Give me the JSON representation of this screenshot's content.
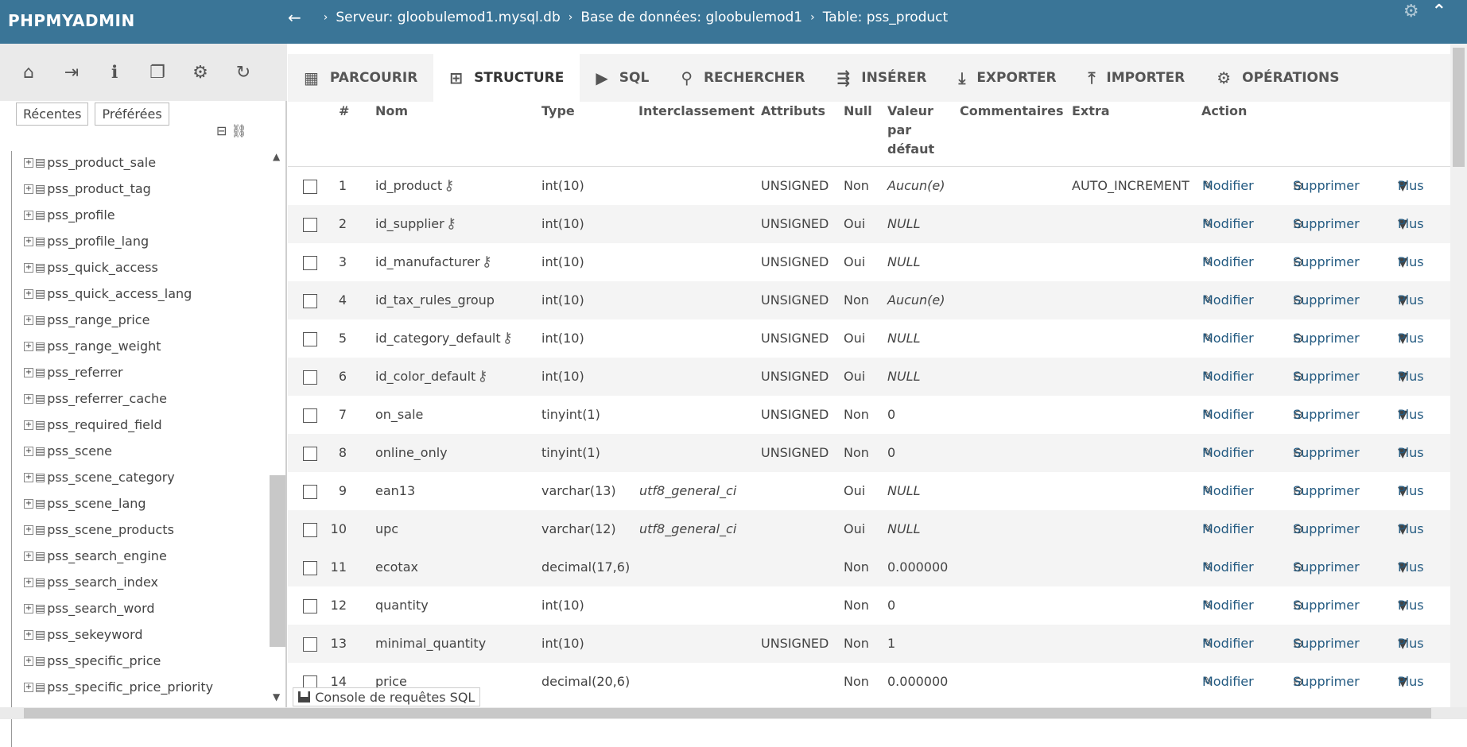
{
  "app": {
    "logo": "PHPMYADMIN"
  },
  "breadcrumb": {
    "back": "←",
    "server": "Serveur: gloobulemod1.mysql.db",
    "database": "Base de données: gloobulemod1",
    "table": "Table: pss_product"
  },
  "sidebar": {
    "tabs": {
      "recent": "Récentes",
      "favorites": "Préférées"
    },
    "tree": [
      "pss_product_sale",
      "pss_product_tag",
      "pss_profile",
      "pss_profile_lang",
      "pss_quick_access",
      "pss_quick_access_lang",
      "pss_range_price",
      "pss_range_weight",
      "pss_referrer",
      "pss_referrer_cache",
      "pss_required_field",
      "pss_scene",
      "pss_scene_category",
      "pss_scene_lang",
      "pss_scene_products",
      "pss_search_engine",
      "pss_search_index",
      "pss_search_word",
      "pss_sekeyword",
      "pss_specific_price",
      "pss_specific_price_priority"
    ]
  },
  "tabs": [
    "PARCOURIR",
    "STRUCTURE",
    "SQL",
    "RECHERCHER",
    "INSÉRER",
    "EXPORTER",
    "IMPORTER",
    "OPÉRATIONS"
  ],
  "table": {
    "headers": {
      "num": "#",
      "name": "Nom",
      "type": "Type",
      "collation": "Interclassement",
      "attributes": "Attributs",
      "null": "Null",
      "default": "Valeur par défaut",
      "comments": "Commentaires",
      "extra": "Extra",
      "action": "Action"
    },
    "action_labels": {
      "edit": "Modifier",
      "delete": "Supprimer",
      "more": "Plus"
    },
    "rows": [
      {
        "num": "1",
        "name": "id_product",
        "key": true,
        "type": "int(10)",
        "collation": "",
        "attributes": "UNSIGNED",
        "null": "Non",
        "default": "Aucun(e)",
        "default_italic": true,
        "extra": "AUTO_INCREMENT"
      },
      {
        "num": "2",
        "name": "id_supplier",
        "key": true,
        "type": "int(10)",
        "collation": "",
        "attributes": "UNSIGNED",
        "null": "Oui",
        "default": "NULL",
        "default_italic": true,
        "extra": ""
      },
      {
        "num": "3",
        "name": "id_manufacturer",
        "key": true,
        "type": "int(10)",
        "collation": "",
        "attributes": "UNSIGNED",
        "null": "Oui",
        "default": "NULL",
        "default_italic": true,
        "extra": ""
      },
      {
        "num": "4",
        "name": "id_tax_rules_group",
        "key": false,
        "type": "int(10)",
        "collation": "",
        "attributes": "UNSIGNED",
        "null": "Non",
        "default": "Aucun(e)",
        "default_italic": true,
        "extra": ""
      },
      {
        "num": "5",
        "name": "id_category_default",
        "key": true,
        "type": "int(10)",
        "collation": "",
        "attributes": "UNSIGNED",
        "null": "Oui",
        "default": "NULL",
        "default_italic": true,
        "extra": ""
      },
      {
        "num": "6",
        "name": "id_color_default",
        "key": true,
        "type": "int(10)",
        "collation": "",
        "attributes": "UNSIGNED",
        "null": "Oui",
        "default": "NULL",
        "default_italic": true,
        "extra": ""
      },
      {
        "num": "7",
        "name": "on_sale",
        "key": false,
        "type": "tinyint(1)",
        "collation": "",
        "attributes": "UNSIGNED",
        "null": "Non",
        "default": "0",
        "default_italic": false,
        "extra": ""
      },
      {
        "num": "8",
        "name": "online_only",
        "key": false,
        "type": "tinyint(1)",
        "collation": "",
        "attributes": "UNSIGNED",
        "null": "Non",
        "default": "0",
        "default_italic": false,
        "extra": ""
      },
      {
        "num": "9",
        "name": "ean13",
        "key": false,
        "type": "varchar(13)",
        "collation": "utf8_general_ci",
        "attributes": "",
        "null": "Oui",
        "default": "NULL",
        "default_italic": true,
        "extra": ""
      },
      {
        "num": "10",
        "name": "upc",
        "key": false,
        "type": "varchar(12)",
        "collation": "utf8_general_ci",
        "attributes": "",
        "null": "Oui",
        "default": "NULL",
        "default_italic": true,
        "extra": ""
      },
      {
        "num": "11",
        "name": "ecotax",
        "key": false,
        "type": "decimal(17,6)",
        "collation": "",
        "attributes": "",
        "null": "Non",
        "default": "0.000000",
        "default_italic": false,
        "extra": ""
      },
      {
        "num": "12",
        "name": "quantity",
        "key": false,
        "type": "int(10)",
        "collation": "",
        "attributes": "",
        "null": "Non",
        "default": "0",
        "default_italic": false,
        "extra": ""
      },
      {
        "num": "13",
        "name": "minimal_quantity",
        "key": false,
        "type": "int(10)",
        "collation": "",
        "attributes": "UNSIGNED",
        "null": "Non",
        "default": "1",
        "default_italic": false,
        "extra": ""
      },
      {
        "num": "14",
        "name": "price",
        "key": false,
        "type": "decimal(20,6)",
        "collation": "",
        "attributes": "",
        "null": "Non",
        "default": "0.000000",
        "default_italic": false,
        "extra": ""
      }
    ]
  },
  "console": {
    "label": "Console de requêtes SQL"
  }
}
